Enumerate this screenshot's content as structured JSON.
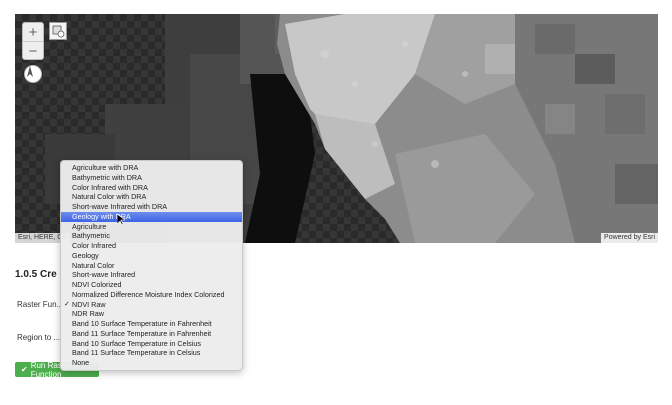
{
  "map": {
    "attribution_left": "Esri, HERE, Ga",
    "attribution_right": "Powered by Esri",
    "zoom_in_label": "+",
    "zoom_out_label": "−",
    "icons": [
      "layers-icon",
      "compass-icon"
    ]
  },
  "section": {
    "title": "1.0.5  Cre"
  },
  "form": {
    "raster_function_label": "Raster Fun...",
    "region_label": "Region to ...",
    "run_button_label": "Run Raster Function"
  },
  "dropdown": {
    "options": [
      "Agriculture with DRA",
      "Bathymetric with DRA",
      "Color Infrared with DRA",
      "Natural Color with DRA",
      "Short-wave Infrared with DRA",
      "Geology with DRA",
      "Agriculture",
      "Bathymetric",
      "Color Infrared",
      "Geology",
      "Natural Color",
      "Short-wave Infrared",
      "NDVI Colorized",
      "Normalized Difference Moisture Index Colorized",
      "NDVI Raw",
      "NDR Raw",
      "Band 10 Surface Temperature in Fahrenheit",
      "Band 11 Surface Temperature in Fahrenheit",
      "Band 10 Surface Temperature in Celsius",
      "Band 11 Surface Temperature in Celsius",
      "None"
    ],
    "highlighted_option": "Geology with DRA",
    "checked_option": "NDVI Raw",
    "check_mark": "✓"
  },
  "colors": {
    "highlight": "#3d64e6",
    "button": "#4cae4c"
  }
}
